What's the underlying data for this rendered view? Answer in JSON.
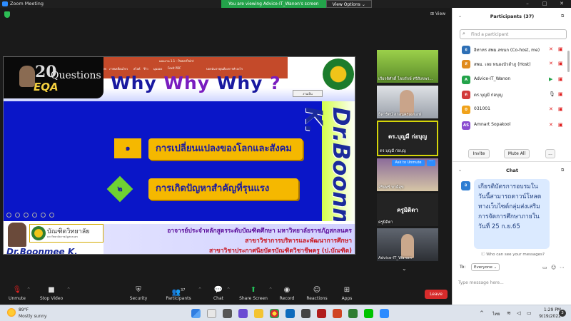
{
  "window": {
    "title": "Zoom Meeting",
    "share_banner": "You are viewing Advice-IT_Wanon's screen",
    "view_options": "View Options",
    "view_options_caret": "⌄",
    "minimize": "–",
    "maximize": "□",
    "close": "✕",
    "view_label": "View"
  },
  "slide": {
    "ppt_tabs": [
      "การเลื่อน",
      "การเปลี่ยนภาพ",
      "ภาพเคลื่อนไหว",
      "สไลด์",
      "รีวิว",
      "มุมมอง",
      "Foxit PDF"
    ],
    "ppt_title": "แผนงาน 1.1 - PowerPoint",
    "ppt_search": "บอกฉันว่าคุณต้องการทำอะไร",
    "logo_number": "20",
    "logo_questions": "Questions",
    "logo_eqa": "EQA",
    "why_words": [
      "Why",
      "Why",
      "Why",
      "?"
    ],
    "float_button": "งานเป็น",
    "side_name": "Dr.Boonmee K.",
    "item1_num": "๑",
    "item1_text": "การเปลี่ยนแปลงของโลกและสังคม",
    "item2_num": "๒",
    "item2_text": "การเกิดปัญหาสำคัญที่รุนแรง",
    "uni_name": "บัณฑิตวิทยาลัย",
    "uni_sub": "มหาวิทยาลัยราชภัฏสกลนคร",
    "bottom_name": "Dr.Boonmee K.",
    "info_line1": "อาจารย์ประจำหลักสูตรระดับบัณฑิตศึกษา มหาวิทยาลัยราชภัฏสกลนคร",
    "info_line2": "สาขาวิชาการบริหารและพัฒนาการศึกษา",
    "info_line3": "สาขาวิชาประกาศนียบัตรบัณฑิตวิชาชีพครู (ป.บัณฑิต)"
  },
  "videos": [
    {
      "label": "เกียรติศักดิ์ ไชยรักษ์ ศรีสังขพร..."
    },
    {
      "label": "ธิดารัตน์ สกลนครเอสเอฟ"
    },
    {
      "label": "ดร.บุญมี ก่อบุญ",
      "sub": "ดร.บุญมี ก่อบุญ"
    },
    {
      "label": "จรินทร์ ทาดีสุข",
      "ask": "Ask to Unmute",
      "more": "···"
    },
    {
      "label": "ครูมิดิตา",
      "sub": "ครูมิดิตา"
    },
    {
      "label": "Advice-IT_Wanon"
    }
  ],
  "strip_chevron": "⌄",
  "toolbar": {
    "unmute": "Unmute",
    "stop_video": "Stop Video",
    "security": "Security",
    "participants": "Participants",
    "participants_count": "37",
    "chat": "Chat",
    "share_screen": "Share Screen",
    "record": "Record",
    "reactions": "Reactions",
    "apps": "Apps",
    "leave": "Leave"
  },
  "participants_panel": {
    "title": "Participants (37)",
    "collapse": "⌄",
    "popout": "⧉",
    "search_placeholder": "Find a participant",
    "rows": [
      {
        "initial": "อ",
        "name": "อิทาหร สพม.ลขนก (Co-host, me)",
        "color": "#2d6fb5"
      },
      {
        "initial": "ส",
        "name": "สพม. เลย หนองบัวลำภู (Host)",
        "color": "#e08a1c"
      },
      {
        "initial": "A",
        "name": "Advice-IT_Wanon",
        "color": "#23a34a"
      },
      {
        "initial": "ด",
        "name": "ดร.บุญมี ก่อบุญ",
        "color": "#d23a3a"
      },
      {
        "initial": "0",
        "name": "031001",
        "color": "#f0a21b"
      },
      {
        "initial": "AS",
        "name": "Amnart Sopakool",
        "color": "#8a4bd0"
      }
    ],
    "invite": "Invite",
    "mute_all": "Mute All",
    "more": "..."
  },
  "chat_panel": {
    "title": "Chat",
    "collapse": "⌄",
    "popout": "⧉",
    "sender_initial": "อ",
    "message": "เกียรติบัตรการอบรมในวันนี้สามารถดาวน์โหลดทางเว็บไซต์กลุ่มส่งเสริมการจัดการศึกษาภายในวันที่ 25 ก.ย.65",
    "who_can_see": "Who can see your messages?",
    "to_label": "To:",
    "to_value": "Everyone",
    "input_placeholder": "Type message here..."
  },
  "taskbar": {
    "temp": "89°F",
    "condition": "Mostly sunny",
    "lang": "ไทย",
    "time": "1:29 PM",
    "date": "9/19/2022",
    "notifications": "3"
  },
  "colors": {
    "zoom_blue": "#2d8cff",
    "share_green": "#23a34a",
    "leave_red": "#d72b2b"
  }
}
